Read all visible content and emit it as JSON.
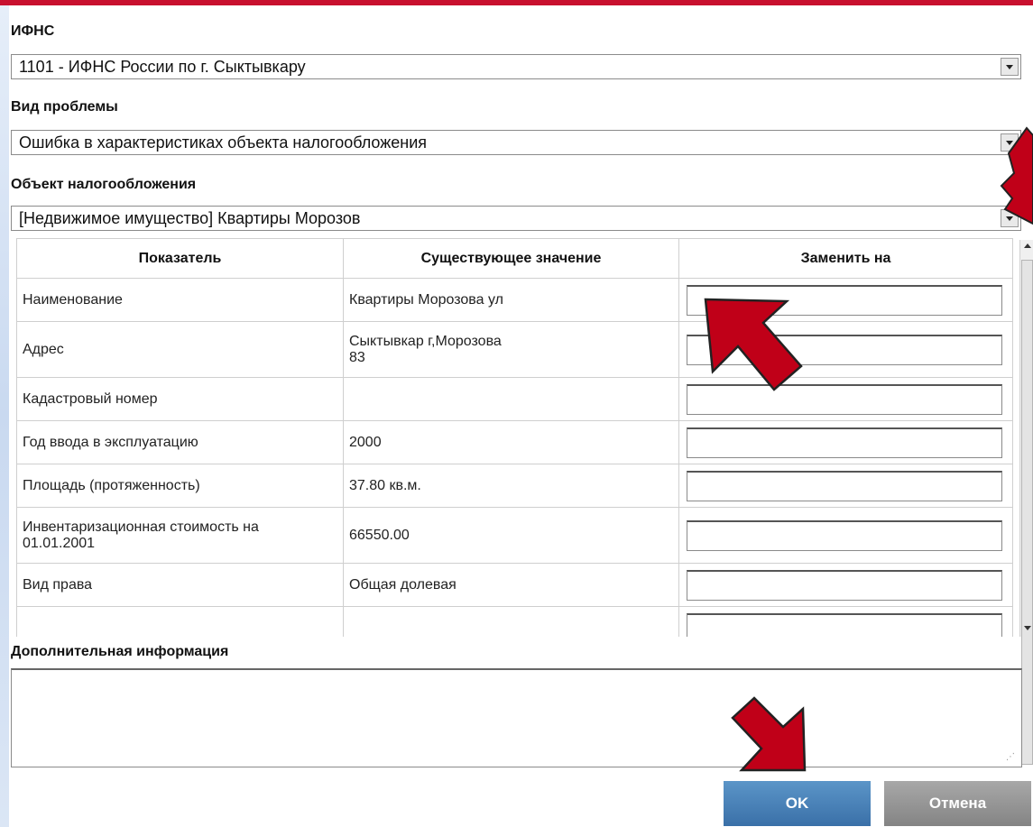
{
  "ifns": {
    "label": "ИФНС",
    "value": "1101 - ИФНС России по г. Сыктывкару"
  },
  "problem_type": {
    "label": "Вид проблемы",
    "value": "Ошибка в характеристиках объекта налогообложения"
  },
  "tax_object": {
    "label": "Объект налогообложения",
    "value": "[Недвижимое имущество] Квартиры Морозов"
  },
  "table": {
    "headers": [
      "Показатель",
      "Существующее значение",
      "Заменить на"
    ],
    "rows": [
      {
        "indicator": "Наименование",
        "current": "Квартиры Морозова ул",
        "replace": ""
      },
      {
        "indicator": "Адрес",
        "current": "Сыктывкар г,Морозова",
        "current_line2": "83",
        "replace": ""
      },
      {
        "indicator": "Кадастровый номер",
        "current": "",
        "replace": ""
      },
      {
        "indicator": "Год ввода в эксплуатацию",
        "current": "2000",
        "replace": ""
      },
      {
        "indicator": "Площадь (протяженность)",
        "current": "37.80 кв.м.",
        "replace": ""
      },
      {
        "indicator": "Инвентаризационная стоимость на",
        "indicator_line2": "01.01.2001",
        "current": "66550.00",
        "replace": ""
      },
      {
        "indicator": "Вид права",
        "current": "Общая долевая",
        "replace": ""
      }
    ]
  },
  "additional_info": {
    "label": "Дополнительная информация",
    "value": ""
  },
  "buttons": {
    "ok": "OK",
    "cancel": "Отмена"
  },
  "colors": {
    "top_bar": "#c8102e",
    "annotation_arrow": "#c00018",
    "ok_button": "#4a82b8",
    "cancel_button": "#969696"
  },
  "icons": {
    "dropdown": "chevron-down-icon",
    "annotation": "arrow-pointer-icon"
  }
}
